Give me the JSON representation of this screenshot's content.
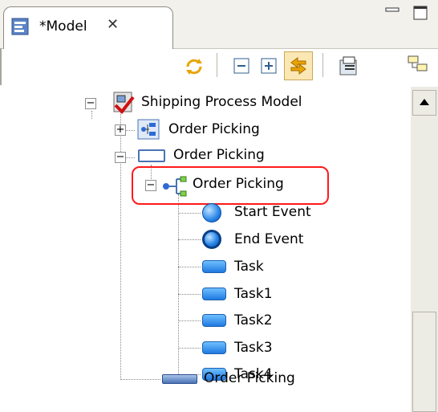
{
  "window": {
    "tab_title": "*Model",
    "tab_close_glyph": "✕"
  },
  "toolbar": {
    "icons": [
      "sync-icon",
      "collapse-all-icon",
      "expand-all-icon",
      "link-with-editor-icon",
      "filter-icon",
      "hierarchy-icon"
    ]
  },
  "tree": {
    "root_label": "Shipping Process Model",
    "child1_label": "Order Picking",
    "child2_label": "Order Picking",
    "process_label": "Order Picking",
    "start_event_label": "Start Event",
    "end_event_label": "End Event",
    "task_labels": [
      "Task",
      "Task1",
      "Task2",
      "Task3",
      "Task4"
    ],
    "pool_label": "Order Picking"
  },
  "colors": {
    "highlight": "#ff1a1a",
    "task_blue": "#1f7ae0"
  }
}
